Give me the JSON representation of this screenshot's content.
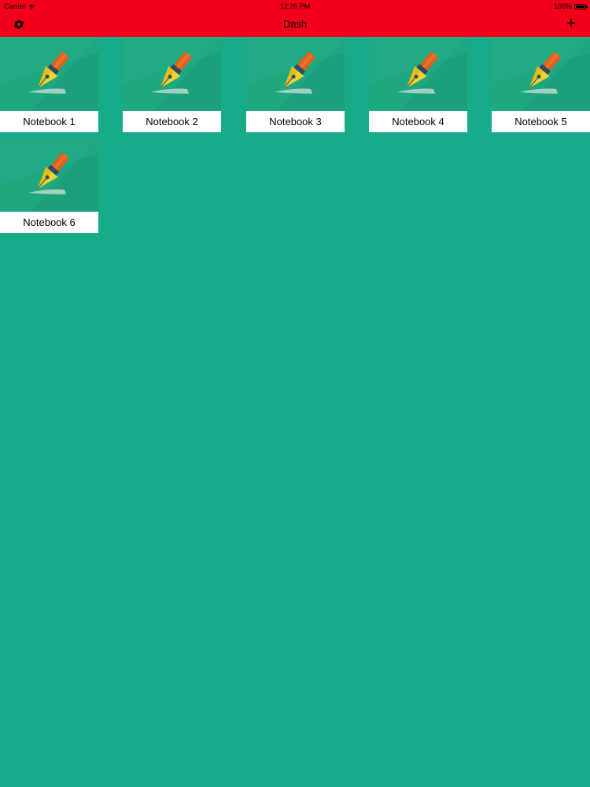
{
  "status_bar": {
    "carrier": "Carrier",
    "time": "12:26 PM",
    "battery": "100%"
  },
  "nav": {
    "title": "Dash",
    "settings_icon": "gear-icon",
    "add_icon": "plus-icon",
    "add_symbol": "+"
  },
  "colors": {
    "nav_background": "#f2001b",
    "page_background": "#18ab89",
    "caption_background": "#ffffff"
  },
  "notebooks": [
    {
      "title": "Notebook 1",
      "icon": "fountain-pen-icon"
    },
    {
      "title": "Notebook 2",
      "icon": "fountain-pen-icon"
    },
    {
      "title": "Notebook 3",
      "icon": "fountain-pen-icon"
    },
    {
      "title": "Notebook 4",
      "icon": "fountain-pen-icon"
    },
    {
      "title": "Notebook 5",
      "icon": "fountain-pen-icon"
    },
    {
      "title": "Notebook 6",
      "icon": "fountain-pen-icon"
    }
  ]
}
